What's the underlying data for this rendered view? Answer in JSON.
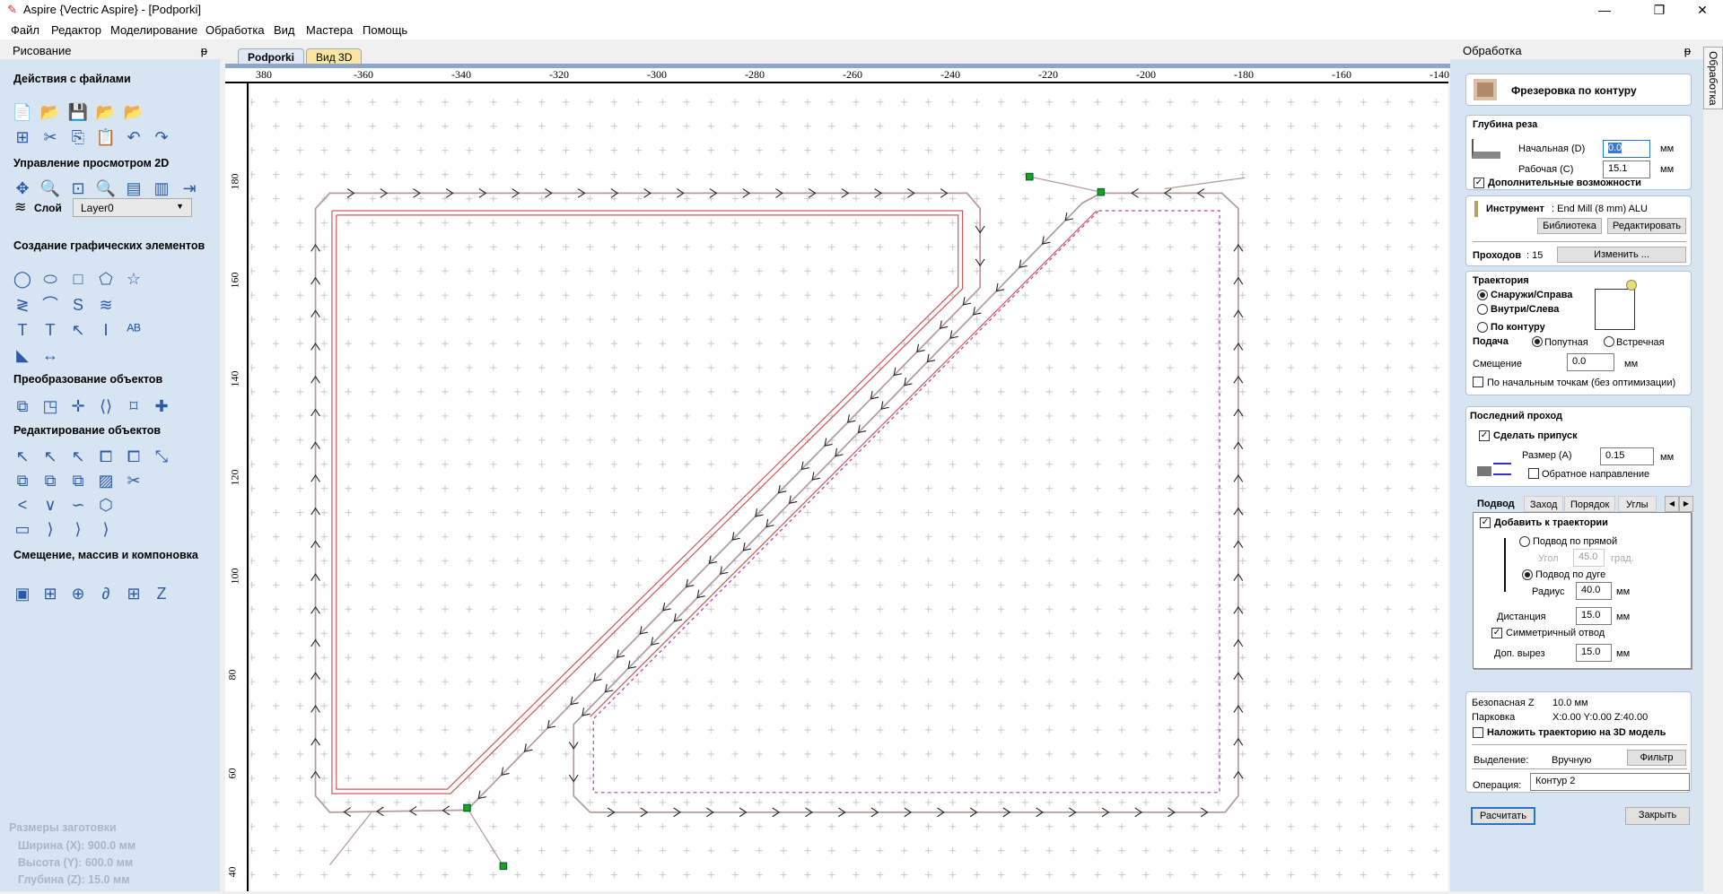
{
  "window": {
    "title": "Aspire {Vectric Aspire} - [Podporki]",
    "minimize": "—",
    "restore": "❐",
    "close": "✕"
  },
  "menu": [
    "Файл",
    "Редактор",
    "Моделирование",
    "Обработка",
    "Вид",
    "Мастера",
    "Помощь"
  ],
  "left_panel": {
    "title": "Рисование",
    "pin": "ᵽ",
    "sections": [
      "Действия с файлами",
      "Управление просмотром 2D",
      "Создание графических элементов",
      "Преобразование объектов",
      "Редактирование объектов",
      "Смещение, массив и компоновка"
    ],
    "layer_label": "Слой",
    "layer_value": "Layer0",
    "material": {
      "title": "Размеры заготовки",
      "width": "Ширина  (X): 900.0 мм",
      "height": "Высота  (Y): 600.0 мм",
      "depth": "Глубина (Z): 15.0 мм"
    }
  },
  "tabs": [
    {
      "label": "Podporki",
      "active": true
    },
    {
      "label": "Вид 3D",
      "active": false
    }
  ],
  "ruler": {
    "x": [
      "380",
      "-360",
      "-340",
      "-320",
      "-300",
      "-280",
      "-260",
      "-240",
      "-220",
      "-200",
      "-180",
      "-160",
      "-140"
    ],
    "y": [
      "180",
      "160",
      "140",
      "120",
      "100",
      "80",
      "60",
      "40"
    ]
  },
  "colors": {
    "toolpath": "#b49a9a",
    "vector": "#d05a5a",
    "selected": "#b040b0",
    "start_point": "#1fa01f",
    "annotation": "#e8404a",
    "panel_bg": "#d7e4f2"
  },
  "right_panel": {
    "title": "Обработка",
    "side_tab": "Обработка",
    "operation_type": "Фрезеровка по контуру",
    "depth": {
      "title": "Глубина реза",
      "start_label": "Начальная (D)",
      "start_value": "0.0",
      "cut_label": "Рабочая (C)",
      "cut_value": "15.1",
      "unit": "мм",
      "advanced": "Дополнительные возможности",
      "advanced_checked": true
    },
    "tool": {
      "label": "Инструмент",
      "value": ": End Mill (8 mm) ALU",
      "library": "Библиотека",
      "edit": "Редактировать",
      "passes_label": "Проходов",
      "passes_value": ": 15",
      "change": "Изменить ..."
    },
    "path": {
      "title": "Траектория",
      "outside": "Снаружи/Справа",
      "inside": "Внутри/Слева",
      "on": "По контуру",
      "selected": "outside",
      "feed_label": "Подача",
      "climb": "Попутная",
      "conventional": "Встречная",
      "feed_selected": "climb",
      "offset_label": "Смещение",
      "offset_value": "0.0",
      "unit": "мм",
      "start_points": "По начальным точкам (без оптимизации)",
      "start_points_checked": false
    },
    "last_pass": {
      "title": "Последний проход",
      "allowance": "Сделать припуск",
      "allowance_checked": true,
      "size_label": "Размер (A)",
      "size_value": "0.15",
      "unit": "мм",
      "reverse": "Обратное направление",
      "reverse_checked": false
    },
    "subtabs": [
      "Подвод",
      "Заход",
      "Порядок",
      "Углы"
    ],
    "leadin": {
      "add": "Добавить к траектории",
      "add_checked": true,
      "linear": "Подвод по прямой",
      "angle_label": "Угол",
      "angle_value": "45.0",
      "angle_unit": "град.",
      "arc": "Подвод по дуге",
      "mode": "arc",
      "radius_label": "Радиус",
      "radius_value": "40.0",
      "distance_label": "Дистанция",
      "distance_value": "15.0",
      "sym": "Симметричный отвод",
      "sym_checked": true,
      "overcut_label": "Доп. вырез",
      "overcut_value": "15.0",
      "unit": "мм"
    },
    "safe_z_label": "Безопасная Z",
    "safe_z_value": "10.0 мм",
    "home_label": "Парковка",
    "home_value": "X:0.00 Y:0.00 Z:40.00",
    "project": "Наложить траекторию на 3D модель",
    "project_checked": false,
    "selection_label": "Выделение:",
    "selection_value": "Вручную",
    "filter": "Фильтр",
    "operation_label": "Операция:",
    "operation_value": "Контур 2",
    "calculate": "Расчитать",
    "close": "Закрыть"
  }
}
